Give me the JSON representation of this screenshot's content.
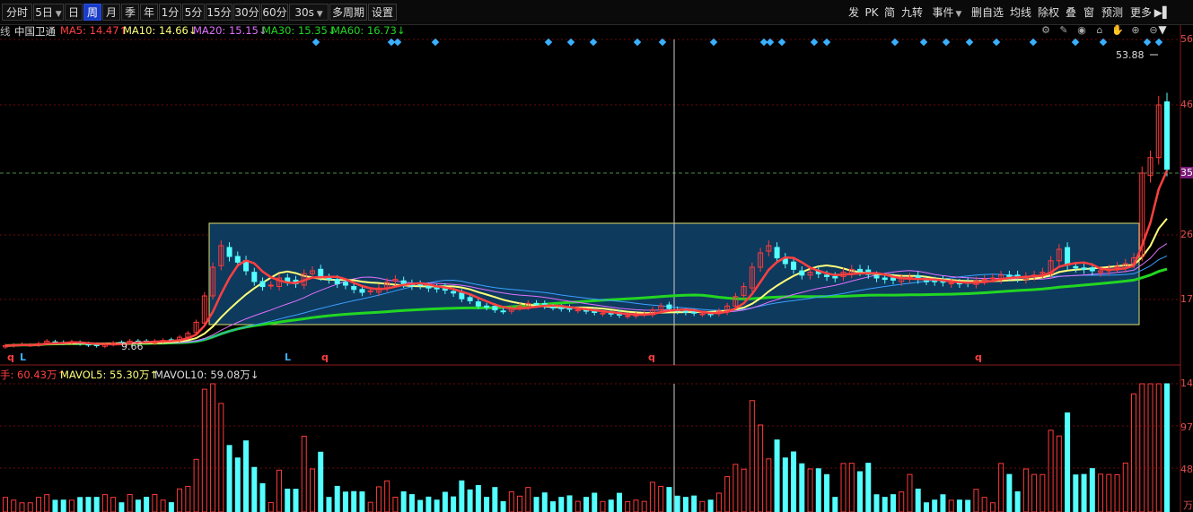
{
  "toolbar": {
    "left": [
      {
        "id": "fenshi",
        "label": "分时"
      },
      {
        "id": "5ri",
        "label": "5日"
      },
      {
        "id": "ri",
        "label": "日"
      },
      {
        "id": "zhou",
        "label": "周"
      },
      {
        "id": "yue",
        "label": "月"
      },
      {
        "id": "ji",
        "label": "季"
      },
      {
        "id": "nian",
        "label": "年"
      },
      {
        "id": "1fen",
        "label": "1分"
      },
      {
        "id": "5fen",
        "label": "5分"
      },
      {
        "id": "15fen",
        "label": "15分"
      },
      {
        "id": "30fen",
        "label": "30分"
      },
      {
        "id": "60fen",
        "label": "60分"
      },
      {
        "id": "30s",
        "label": "30s"
      },
      {
        "id": "duozhouqi",
        "label": "多周期"
      },
      {
        "id": "shezhi",
        "label": "设置"
      }
    ],
    "active": "周",
    "right": [
      {
        "id": "fa",
        "label": "发"
      },
      {
        "id": "pk",
        "label": "PK"
      },
      {
        "id": "jian",
        "label": "简"
      },
      {
        "id": "jiuzhuan",
        "label": "九转"
      },
      {
        "id": "shijian",
        "label": "事件"
      },
      {
        "id": "shanzixuan",
        "label": "删自选"
      },
      {
        "id": "junxian",
        "label": "均线"
      },
      {
        "id": "chuquan",
        "label": "除权"
      },
      {
        "id": "die",
        "label": "叠"
      },
      {
        "id": "chuang",
        "label": "窗"
      },
      {
        "id": "yuce",
        "label": "预测"
      },
      {
        "id": "gengduo",
        "label": "更多"
      }
    ]
  },
  "info": {
    "prefix": "线",
    "stock": "中国卫通",
    "ma5": "MA5: 14.47↑",
    "ma10": "MA10: 14.66↓",
    "ma20": "MA20: 15.15↓",
    "ma30": "MA30: 15.35↓",
    "ma60": "MA60: 16.73↓"
  },
  "volume_info": {
    "vol": "手: 60.43万↑",
    "mavol5": "MAVOL5: 55.30万↑",
    "mavol10": "MAVOL10: 59.08万↓"
  },
  "price_axis": {
    "top": "56",
    "l46": "46",
    "l35": "35",
    "l26": "26",
    "l17": "17"
  },
  "vol_axis": {
    "top": "14",
    "mid": "97",
    "low": "48",
    "unit": "万"
  },
  "labels": {
    "high": "53.88",
    "low": "9.66",
    "markers": [
      "q",
      "L",
      "L",
      "q",
      "q",
      "q"
    ]
  },
  "colors": {
    "up": "#ff3a3a",
    "down": "#54ffff",
    "ma5": "#ff4040",
    "ma10": "#ffff7a",
    "ma20": "#e070ff",
    "ma30": "#22d622",
    "ma60": "#22d622",
    "box_fill": "#0e3a5e",
    "box_border": "#dede70",
    "diamond": "#3ab0ff",
    "grid": "#6b0a0a"
  },
  "chart_data": {
    "type": "candlestick",
    "y_range": [
      9,
      56
    ],
    "ohlc_close_approx": [
      9.9,
      10.0,
      10.1,
      10.0,
      10.2,
      10.6,
      10.4,
      10.3,
      10.5,
      10.2,
      10.0,
      9.9,
      10.1,
      10.3,
      10.4,
      10.6,
      10.5,
      10.4,
      10.6,
      10.7,
      10.8,
      11.2,
      11.8,
      13.5,
      17.5,
      21.5,
      24.5,
      23.0,
      22.2,
      21.0,
      19.5,
      18.8,
      19.0,
      20.0,
      19.5,
      19.2,
      20.6,
      21.0,
      20.2,
      19.8,
      19.2,
      19.0,
      18.4,
      18.0,
      18.2,
      18.6,
      19.4,
      19.8,
      19.2,
      18.9,
      19.0,
      18.6,
      18.5,
      18.3,
      17.9,
      17.1,
      16.8,
      16.0,
      15.8,
      15.4,
      15.2,
      15.6,
      16.0,
      16.4,
      16.2,
      16.0,
      15.8,
      15.6,
      15.5,
      15.4,
      15.2,
      15.0,
      14.9,
      14.8,
      14.6,
      14.5,
      14.6,
      14.8,
      15.4,
      16.0,
      15.6,
      15.2,
      15.0,
      14.9,
      14.8,
      14.7,
      15.2,
      16.0,
      17.4,
      18.8,
      21.5,
      23.5,
      24.5,
      22.8,
      22.0,
      21.2,
      20.4,
      20.8,
      20.6,
      20.2,
      20.0,
      20.8,
      21.2,
      20.9,
      20.5,
      20.0,
      19.8,
      19.7,
      19.9,
      20.1,
      19.8,
      19.6,
      19.5,
      19.4,
      19.3,
      19.2,
      19.3,
      19.6,
      19.8,
      20.0,
      20.4,
      20.2,
      20.0,
      20.2,
      20.4,
      20.8,
      22.4,
      24.0,
      21.8,
      21.4,
      21.2,
      21.0,
      21.0,
      21.2,
      21.6,
      22.0,
      22.8,
      35.0,
      37.5,
      46.0,
      35.6
    ],
    "annotations": {
      "period_high": 53.88,
      "period_low": 9.66
    }
  }
}
